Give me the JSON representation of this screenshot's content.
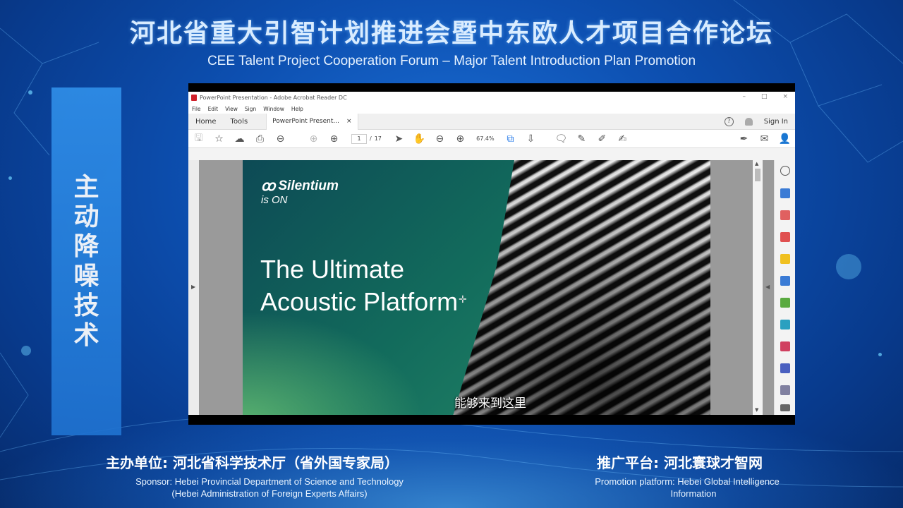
{
  "banner": {
    "title_cn": "河北省重大引智计划推进会暨中东欧人才项目合作论坛",
    "title_en": "CEE Talent Project Cooperation Forum – Major Talent Introduction Plan Promotion"
  },
  "side_panel": {
    "text": "主动降噪技术"
  },
  "acrobat": {
    "window_title": "PowerPoint Presentation - Adobe Acrobat Reader DC",
    "window_controls": [
      "–",
      "□",
      "×"
    ],
    "menu": [
      "File",
      "Edit",
      "View",
      "Sign",
      "Window",
      "Help"
    ],
    "tabs": {
      "home": "Home",
      "tools": "Tools",
      "document": "PowerPoint Present...",
      "close": "×"
    },
    "sign_in": "Sign In",
    "help_icon": "?",
    "page_current": "1",
    "page_separator": "/",
    "page_total": "17",
    "zoom": "67.4%"
  },
  "slide": {
    "brand_mark": "ꝏ",
    "brand_name": "Silentium",
    "brand_sub": "is ON",
    "headline_line1": "The Ultimate",
    "headline_line2": "Acoustic Platform",
    "caption": "能够来到这里"
  },
  "footer": {
    "sponsor_cn": "主办单位: 河北省科学技术厅（省外国专家局）",
    "sponsor_en_line1": "Sponsor: Hebei Provincial Department of Science and Technology",
    "sponsor_en_line2": "(Hebei Administration of Foreign Experts Affairs)",
    "platform_cn": "推广平台: 河北寰球才智网",
    "platform_en_line1": "Promotion platform:   Hebei Global Intelligence",
    "platform_en_line2": "Information"
  },
  "colors": {
    "accent_blue": "#1f72d0",
    "slide_green": "#126b5c",
    "acrobat_red": "#d0202a"
  },
  "icons": [
    "save-icon",
    "star-icon",
    "upload-icon",
    "print-icon",
    "zoom-out-search-icon",
    "prev-page-icon",
    "next-page-icon",
    "select-arrow-icon",
    "hand-icon",
    "zoom-out-icon",
    "zoom-in-icon",
    "fit-page-icon",
    "scroll-mode-icon",
    "comment-icon",
    "pen-icon",
    "highlight-icon",
    "stamp-icon",
    "sign-icon",
    "mail-icon",
    "share-user-icon"
  ]
}
